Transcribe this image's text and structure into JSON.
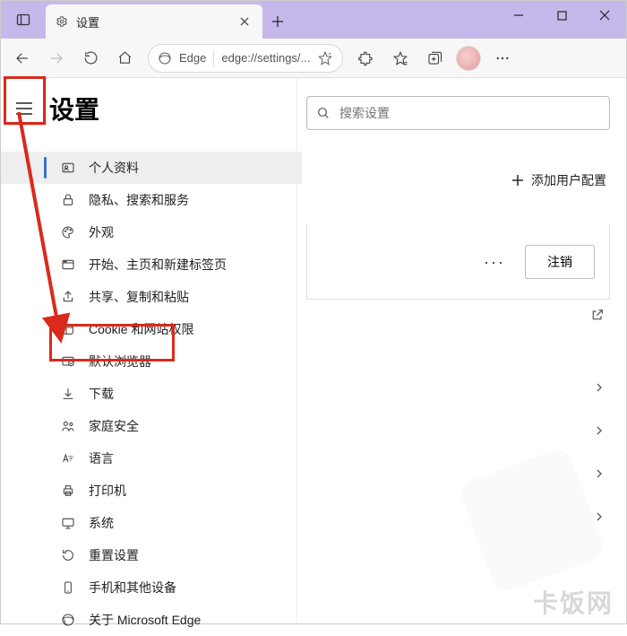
{
  "window": {
    "minimize_icon": "minimize-icon",
    "maximize_icon": "maximize-icon",
    "close_icon": "close-icon"
  },
  "tab": {
    "title": "设置",
    "icon": "gear-icon"
  },
  "toolbar": {
    "back_icon": "arrow-left-icon",
    "forward_icon": "arrow-right-icon",
    "refresh_icon": "refresh-icon",
    "home_icon": "home-icon",
    "edge_label": "Edge",
    "url": "edge://settings/...",
    "addr_star_icon": "sparkle-favorite-icon",
    "extensions_icon": "puzzle-icon",
    "favorites_icon": "star-list-icon",
    "collections_icon": "collections-icon",
    "profile_icon": "avatar",
    "more_icon": "more-horizontal-icon"
  },
  "page": {
    "hamburger_icon": "hamburger-icon",
    "title": "设置"
  },
  "sidebar": {
    "items": [
      {
        "label": "个人资料",
        "icon": "person-card-icon",
        "active": true
      },
      {
        "label": "隐私、搜索和服务",
        "icon": "lock-icon"
      },
      {
        "label": "外观",
        "icon": "palette-icon"
      },
      {
        "label": "开始、主页和新建标签页",
        "icon": "window-new-icon"
      },
      {
        "label": "共享、复制和粘贴",
        "icon": "share-icon"
      },
      {
        "label": "Cookie 和网站权限",
        "icon": "cookie-icon"
      },
      {
        "label": "默认浏览器",
        "icon": "browser-default-icon"
      },
      {
        "label": "下载",
        "icon": "download-icon"
      },
      {
        "label": "家庭安全",
        "icon": "family-icon"
      },
      {
        "label": "语言",
        "icon": "language-icon"
      },
      {
        "label": "打印机",
        "icon": "printer-icon"
      },
      {
        "label": "系统",
        "icon": "system-icon"
      },
      {
        "label": "重置设置",
        "icon": "reset-icon"
      },
      {
        "label": "手机和其他设备",
        "icon": "phone-icon"
      },
      {
        "label": "关于 Microsoft Edge",
        "icon": "edge-icon"
      }
    ]
  },
  "main": {
    "search_placeholder": "搜索设置",
    "add_profile_label": "添加用户配置",
    "more_icon": "more-horizontal-icon",
    "logout_label": "注销",
    "external_icon": "open-external-icon"
  },
  "annotations": {
    "hamburger_highlight": true,
    "default_browser_highlight": true,
    "arrow_from_hamburger_to_default_browser": true
  },
  "watermark": "卡饭网"
}
